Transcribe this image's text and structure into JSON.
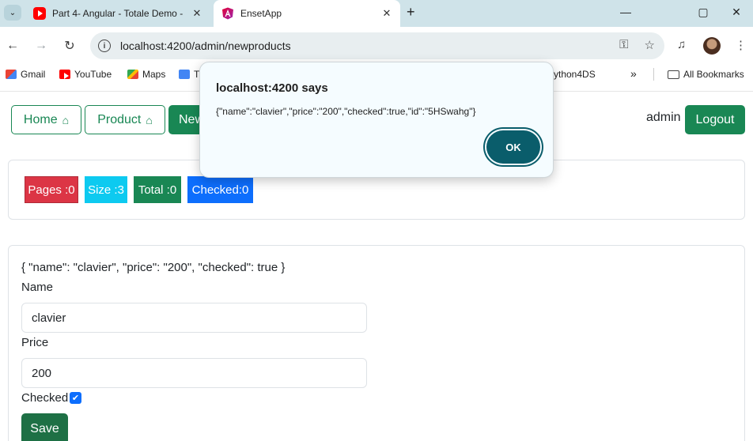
{
  "browser": {
    "tabs": [
      {
        "title": "Part 4- Angular - Totale Demo -",
        "active": false,
        "favicon": "youtube-icon"
      },
      {
        "title": "EnsetApp",
        "active": true,
        "favicon": "angular-icon"
      }
    ],
    "new_tab_symbol": "+",
    "url": "localhost:4200/admin/newproducts",
    "bookmarks": [
      {
        "label": "Gmail",
        "icon": "gmail-icon"
      },
      {
        "label": "YouTube",
        "icon": "youtube-icon"
      },
      {
        "label": "Maps",
        "icon": "maps-icon"
      },
      {
        "label": "T",
        "icon": "translate-icon"
      },
      {
        "label": "ython4DS",
        "icon": "bookmark-icon"
      }
    ],
    "bookmarks_overflow": "»",
    "all_bookmarks": "All Bookmarks"
  },
  "nav": {
    "home": "Home",
    "product": "Product",
    "new_partial": "New",
    "user": "admin",
    "logout": "Logout"
  },
  "stats": {
    "pages": "Pages :0",
    "size": "Size :3",
    "total": "Total :0",
    "checked": "Checked:0"
  },
  "form": {
    "json_preview": "{ \"name\": \"clavier\", \"price\": \"200\", \"checked\": true }",
    "name_label": "Name",
    "name_value": "clavier",
    "price_label": "Price",
    "price_value": "200",
    "checked_label": "Checked",
    "checked": true,
    "save_label": "Save"
  },
  "dialog": {
    "title": "localhost:4200 says",
    "message": "{\"name\":\"clavier\",\"price\":\"200\",\"checked\":true,\"id\":\"5HSwahg\"}",
    "ok_label": "OK"
  },
  "colors": {
    "success": "#198754",
    "danger": "#dc3545",
    "info": "#0dcaf0",
    "primary": "#0d6efd",
    "dialog_button": "#0a5d6b"
  }
}
